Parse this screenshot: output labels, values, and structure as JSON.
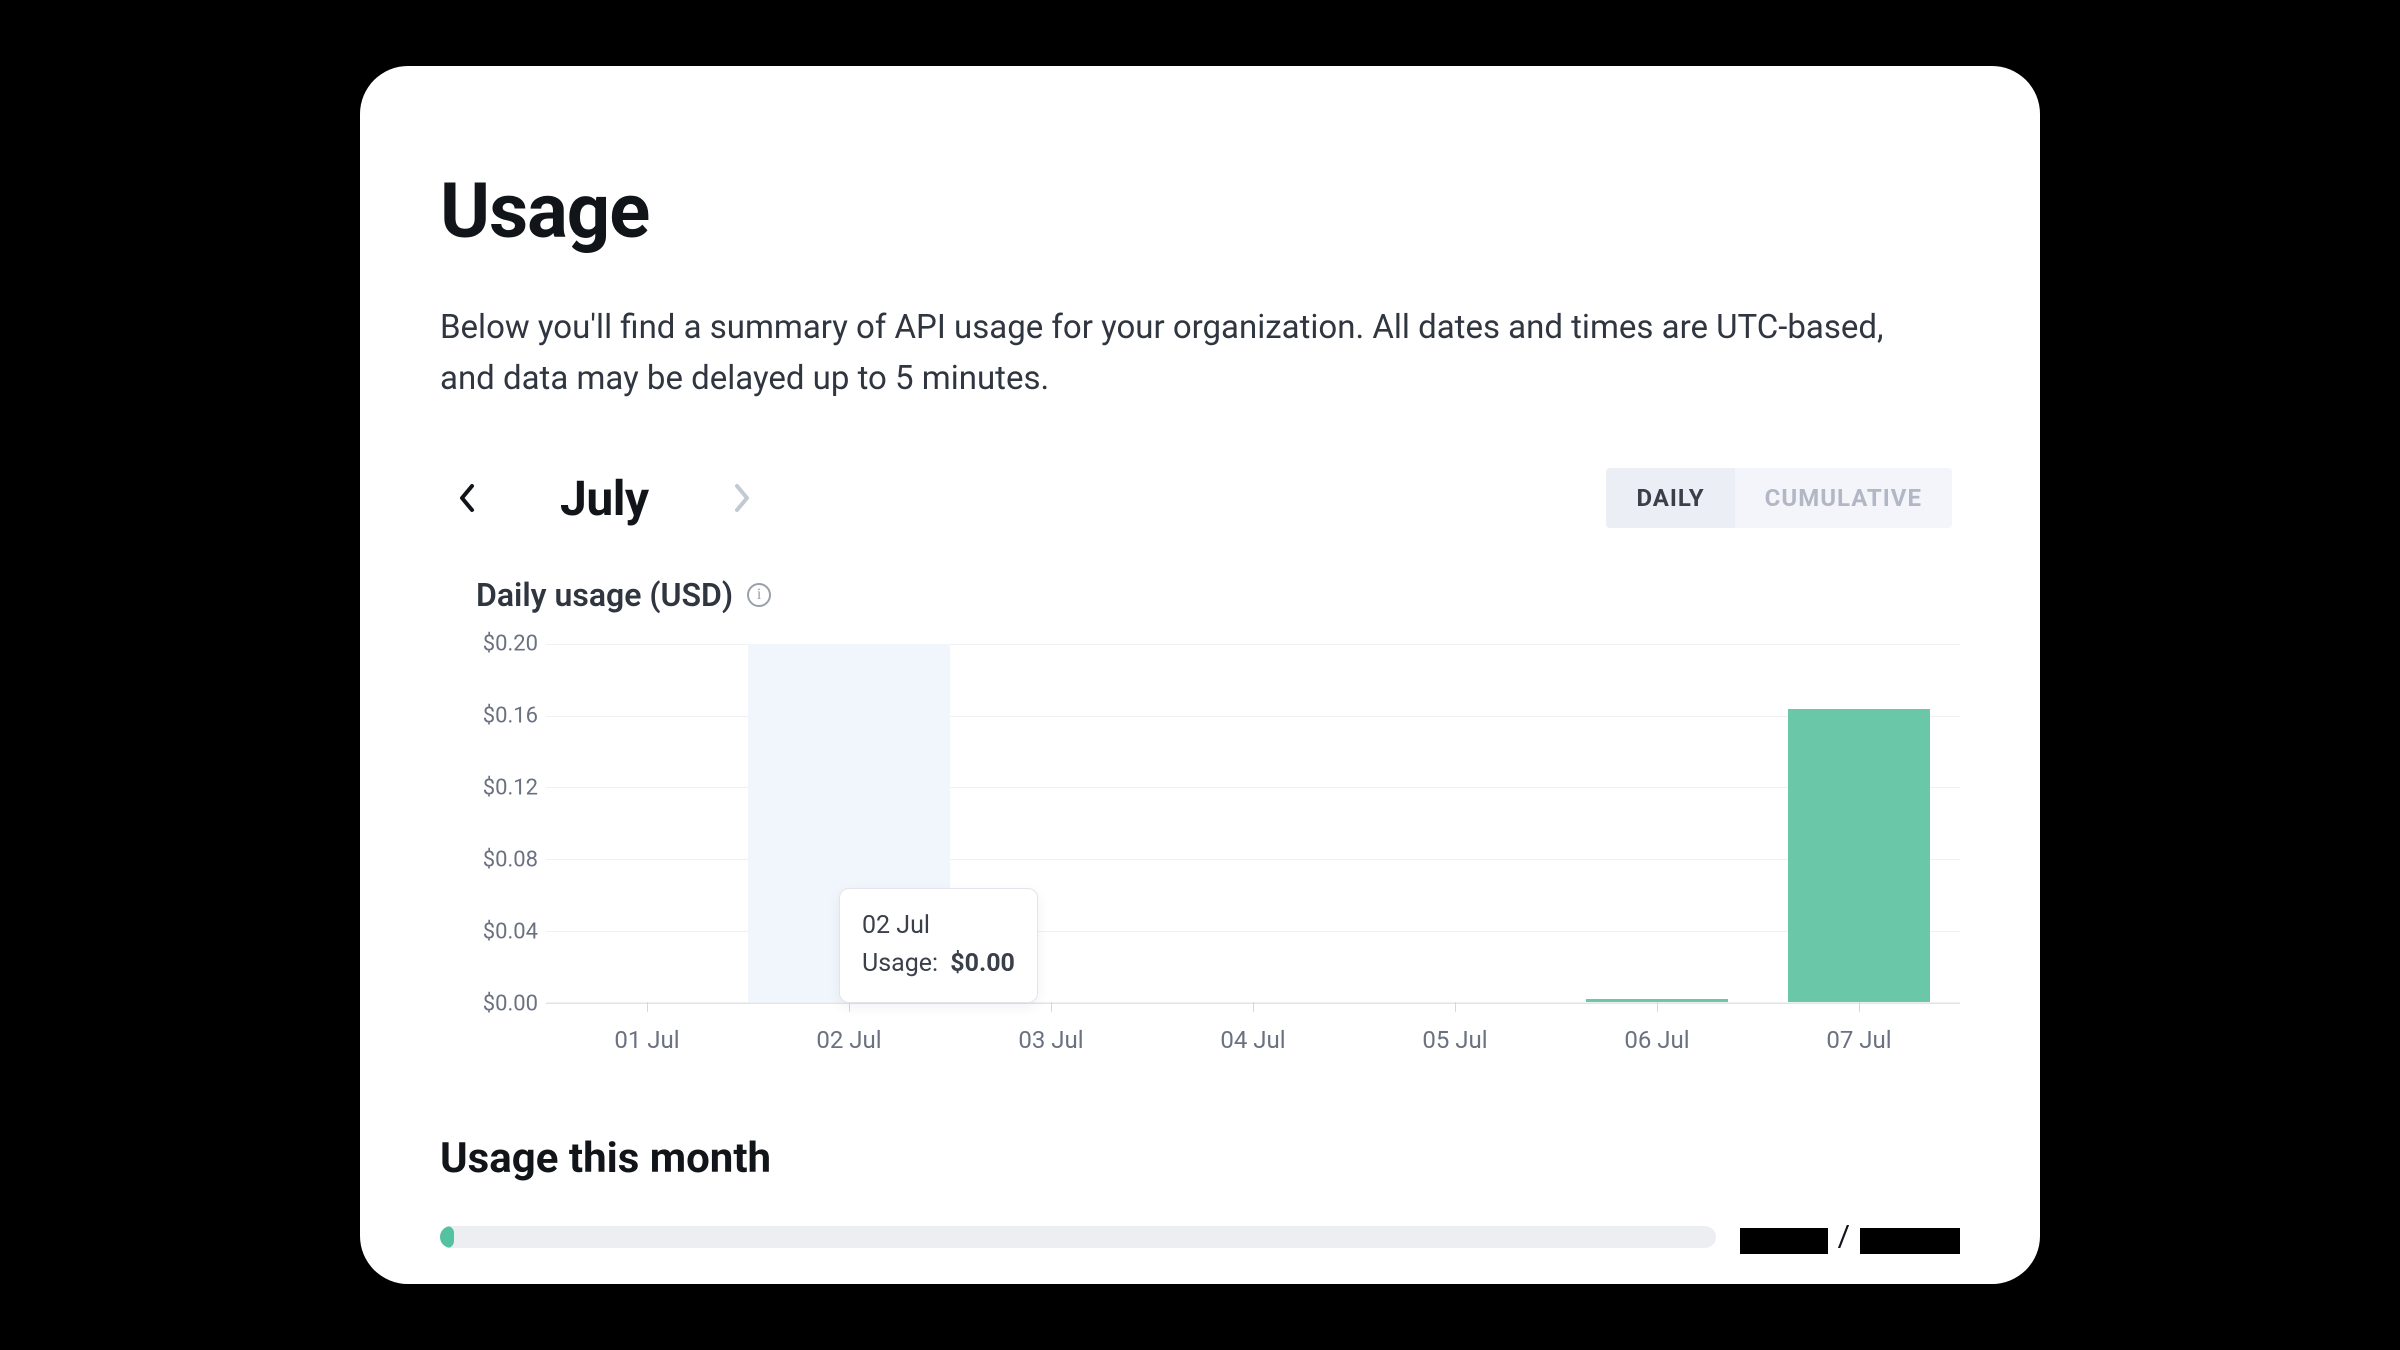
{
  "page": {
    "title": "Usage",
    "description": "Below you'll find a summary of API usage for your organization. All dates and times are UTC-based, and data may be delayed up to 5 minutes."
  },
  "nav": {
    "month_label": "July",
    "prev_enabled": true,
    "next_enabled": false
  },
  "toggle": {
    "options": [
      "DAILY",
      "CUMULATIVE"
    ],
    "active": "DAILY"
  },
  "chart_title": "Daily usage (USD)",
  "tooltip": {
    "date": "02 Jul",
    "usage_label": "Usage:",
    "usage_value": "$0.00",
    "hover_index": 1
  },
  "chart_data": {
    "type": "bar",
    "title": "Daily usage (USD)",
    "xlabel": "",
    "ylabel": "USD",
    "ylim": [
      0,
      0.2
    ],
    "y_ticks": [
      "$0.20",
      "$0.16",
      "$0.12",
      "$0.08",
      "$0.04",
      "$0.00"
    ],
    "categories": [
      "01 Jul",
      "02 Jul",
      "03 Jul",
      "04 Jul",
      "05 Jul",
      "06 Jul",
      "07 Jul"
    ],
    "values": [
      0.0,
      0.0,
      0.0,
      0.0,
      0.0,
      0.002,
      0.164
    ],
    "series_color": "#6ac7a8"
  },
  "month_usage": {
    "title": "Usage this month",
    "progress_fraction": 0.01,
    "current_redacted": true,
    "limit_redacted": true,
    "separator": "/"
  }
}
